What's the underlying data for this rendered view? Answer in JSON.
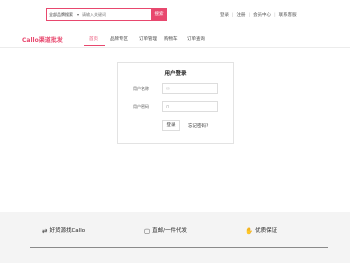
{
  "header": {
    "search": {
      "category": "全部品牌搜索",
      "placeholder": "请输入关键词",
      "button": "搜索"
    },
    "links": [
      "登录",
      "注册",
      "会员中心",
      "联系客服"
    ]
  },
  "nav": {
    "logo": "Callo渠道批发",
    "items": [
      "首页",
      "品牌专区",
      "订单管理",
      "购物车",
      "订单查询"
    ],
    "active_index": 0
  },
  "login": {
    "title": "用户登录",
    "username_label": "用户名称",
    "password_label": "用户密码",
    "username_icon": "user-icon",
    "password_icon": "lock-icon",
    "submit": "登录",
    "forgot": "忘记密码?"
  },
  "footer": {
    "features": [
      {
        "icon": "swap-arrows-icon",
        "label": "好货源找Callo"
      },
      {
        "icon": "box-icon",
        "label": "直邮/一件代发"
      },
      {
        "icon": "thumbs-up-icon",
        "label": "优质保证"
      }
    ]
  },
  "colors": {
    "accent": "#e8486e",
    "footer_bg": "#f4f4f4"
  }
}
